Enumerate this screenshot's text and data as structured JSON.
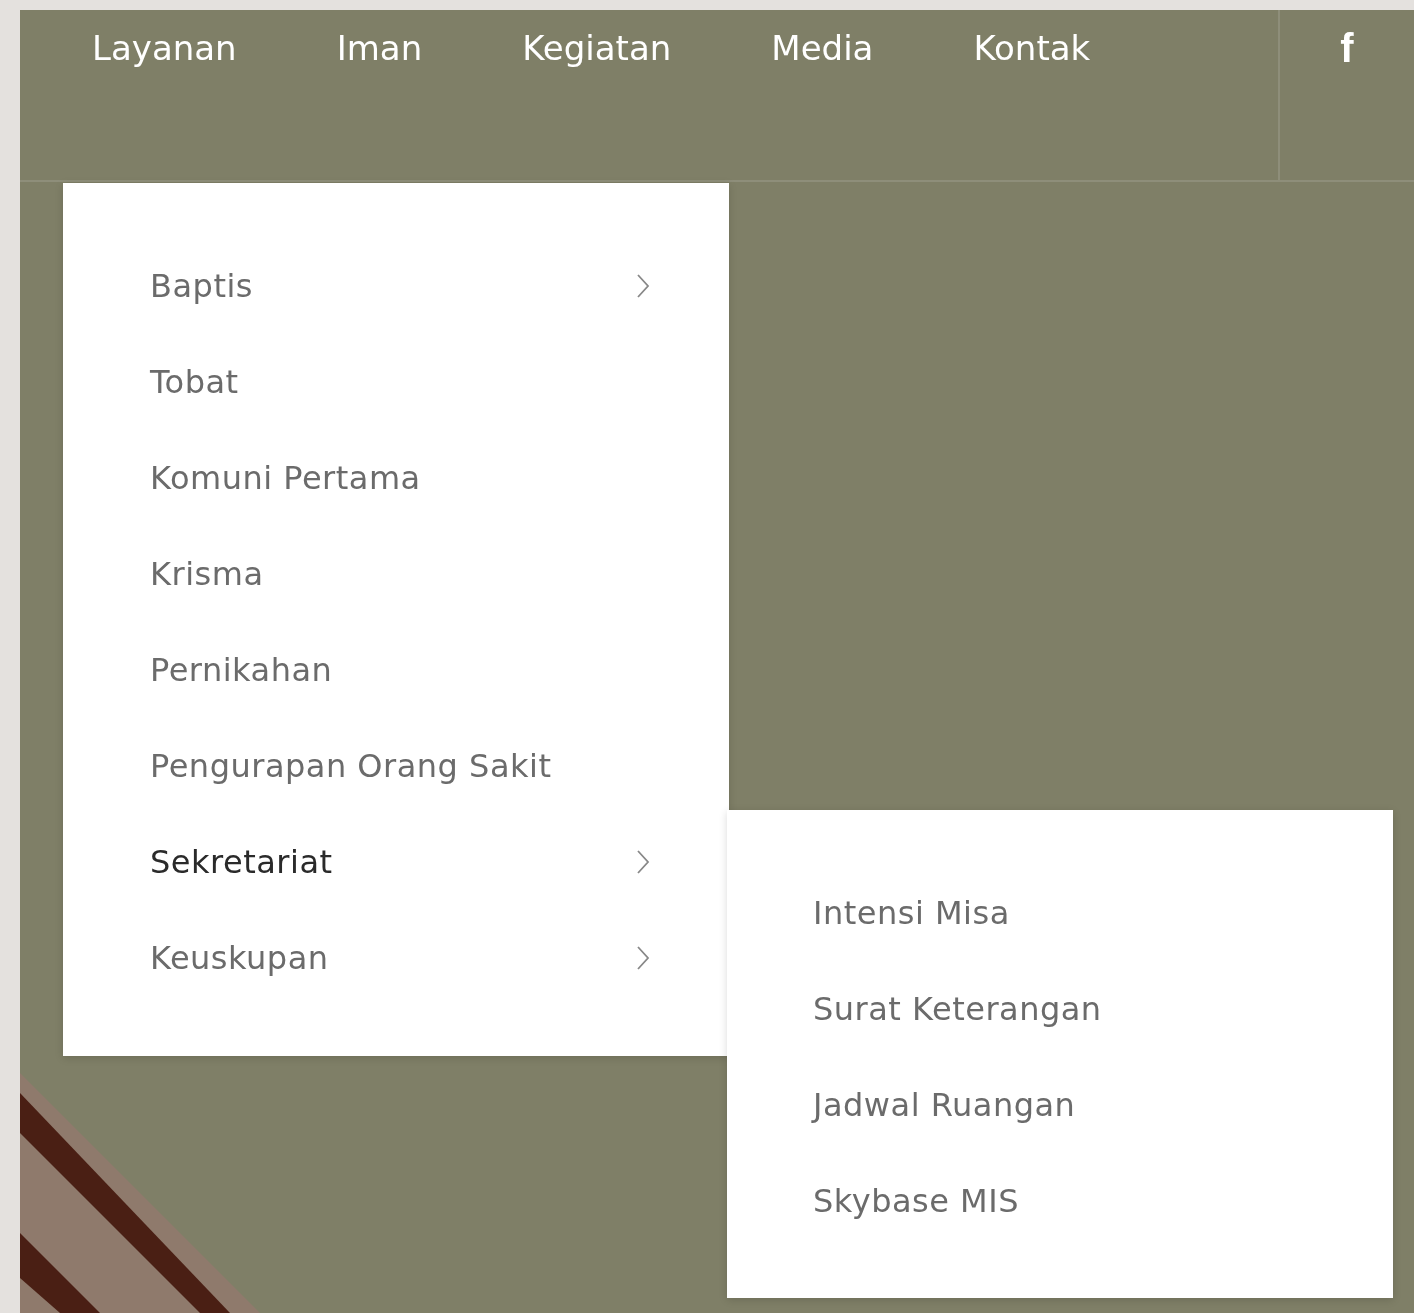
{
  "nav": {
    "items": [
      {
        "label": "Layanan"
      },
      {
        "label": "Iman"
      },
      {
        "label": "Kegiatan"
      },
      {
        "label": "Media"
      },
      {
        "label": "Kontak"
      }
    ],
    "social_icon": "f"
  },
  "dropdown": {
    "items": [
      {
        "label": "Baptis",
        "has_submenu": true,
        "selected": false
      },
      {
        "label": "Tobat",
        "has_submenu": false,
        "selected": false
      },
      {
        "label": "Komuni Pertama",
        "has_submenu": false,
        "selected": false
      },
      {
        "label": "Krisma",
        "has_submenu": false,
        "selected": false
      },
      {
        "label": "Pernikahan",
        "has_submenu": false,
        "selected": false
      },
      {
        "label": "Pengurapan Orang Sakit",
        "has_submenu": false,
        "selected": false
      },
      {
        "label": "Sekretariat",
        "has_submenu": true,
        "selected": true
      },
      {
        "label": "Keuskupan",
        "has_submenu": true,
        "selected": false
      }
    ]
  },
  "submenu": {
    "items": [
      {
        "label": "Intensi Misa"
      },
      {
        "label": "Surat Keterangan"
      },
      {
        "label": "Jadwal Ruangan"
      },
      {
        "label": "Skybase MIS"
      }
    ]
  }
}
